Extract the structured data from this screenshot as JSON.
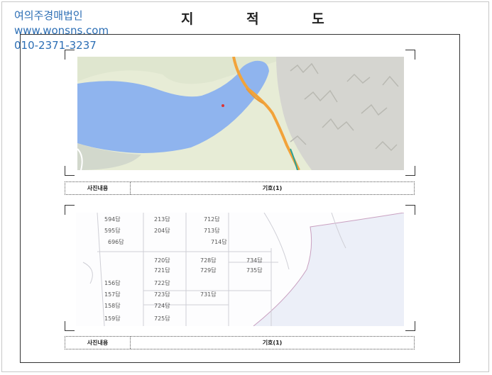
{
  "watermark": {
    "company": "여의주경매법인",
    "website": "www.wonsns.com",
    "phone": "010-2371-3237"
  },
  "document": {
    "title": "지 적 도"
  },
  "panels": [
    {
      "caption_label": "사진내용",
      "caption_value": "기호(1)"
    },
    {
      "caption_label": "사진내용",
      "caption_value": "기호(1)"
    }
  ],
  "cadastral_labels": [
    "594답",
    "213답",
    "712답",
    "595답",
    "204답",
    "713답",
    "696답",
    "714답",
    "720답",
    "728답",
    "734답",
    "721답",
    "729답",
    "735답",
    "156답",
    "722답",
    "157답",
    "723답",
    "731답",
    "158답",
    "724답",
    "159답",
    "725답"
  ],
  "colors": {
    "water": "#8fb4ee",
    "land": "#e7ecd6",
    "road": "#f2a33a",
    "mountain": "#d5d5d0",
    "watermark": "#2d6fb5"
  }
}
